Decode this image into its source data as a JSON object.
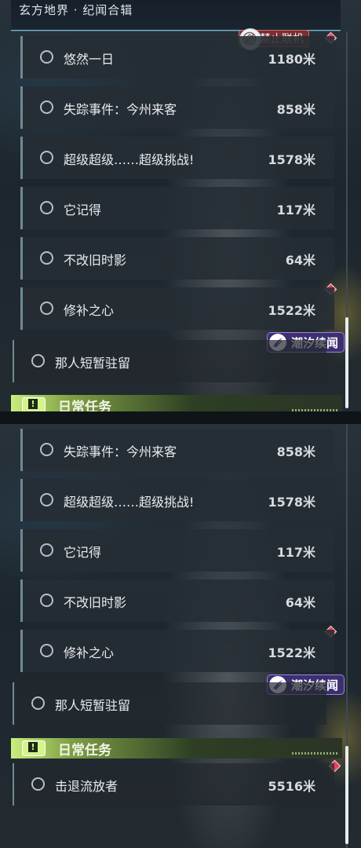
{
  "header": {
    "title": "玄方地界 · 纪闻合辑"
  },
  "badges": {
    "offline": "禁止联机",
    "tide": "潮汐续闻"
  },
  "quests_top": [
    {
      "label": "悠然一日",
      "distance": "1180米"
    },
    {
      "label": "失踪事件：今州来客",
      "distance": "858米"
    },
    {
      "label": "超级超级……超级挑战!",
      "distance": "1578米"
    },
    {
      "label": "它记得",
      "distance": "117米"
    },
    {
      "label": "不改旧时影",
      "distance": "64米"
    },
    {
      "label": "修补之心",
      "distance": "1522米"
    }
  ],
  "quests_bottom": [
    {
      "label": "失踪事件：今州来客",
      "distance": "858米"
    },
    {
      "label": "超级超级……超级挑战!",
      "distance": "1578米"
    },
    {
      "label": "它记得",
      "distance": "117米"
    },
    {
      "label": "不改旧时影",
      "distance": "64米"
    },
    {
      "label": "修补之心",
      "distance": "1522米"
    }
  ],
  "tide_quest": {
    "label": "那人短暂驻留"
  },
  "daily": {
    "title": "日常任务",
    "icon_glyph": "!",
    "quest": {
      "label": "击退流放者",
      "distance": "5516米"
    }
  },
  "colors": {
    "accent_daily": "#c8ee7e",
    "marker": "#e0455d",
    "tide_badge": "#3d3070",
    "offline_badge": "#7a2f33"
  }
}
